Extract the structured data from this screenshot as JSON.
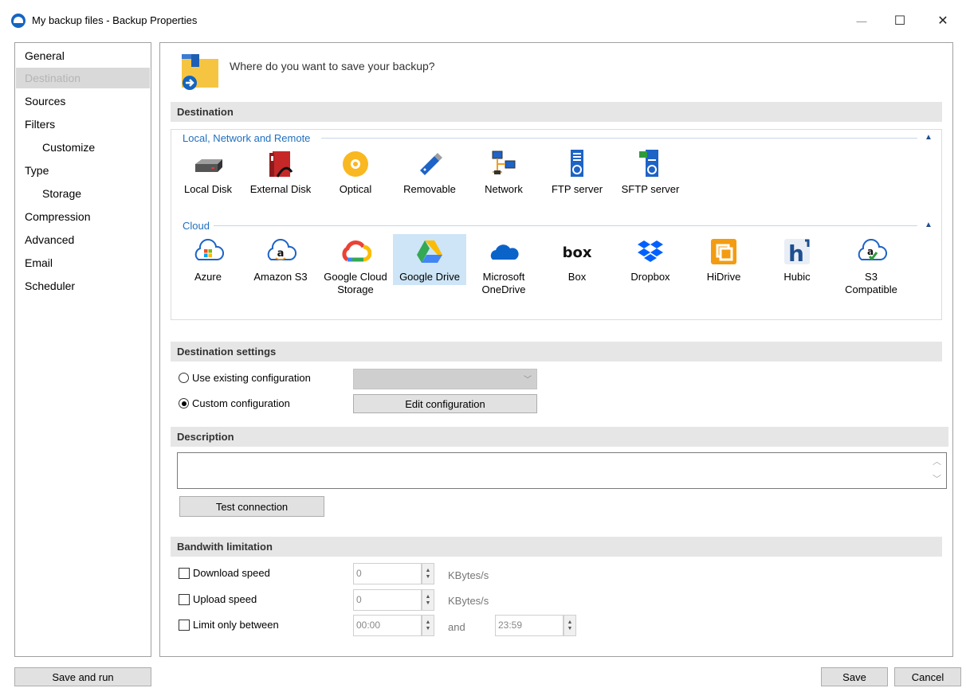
{
  "window": {
    "title": "My backup files - Backup Properties",
    "minimize_glyph": "—",
    "maximize_glyph": "☐",
    "close_glyph": "✕"
  },
  "sidebar": {
    "items": [
      {
        "label": "General"
      },
      {
        "label": "Destination"
      },
      {
        "label": "Sources"
      },
      {
        "label": "Filters"
      },
      {
        "label": "Customize"
      },
      {
        "label": "Type"
      },
      {
        "label": "Storage"
      },
      {
        "label": "Compression"
      },
      {
        "label": "Advanced"
      },
      {
        "label": "Email"
      },
      {
        "label": "Scheduler"
      }
    ]
  },
  "main": {
    "prompt": "Where do you want to save your backup?",
    "destination_header": "Destination",
    "local_group_title": "Local, Network and Remote",
    "cloud_group_title": "Cloud",
    "collapse_glyph": "▲",
    "local_items": [
      {
        "label": "Local Disk"
      },
      {
        "label": "External Disk"
      },
      {
        "label": "Optical"
      },
      {
        "label": "Removable"
      },
      {
        "label": "Network"
      },
      {
        "label": "FTP server"
      },
      {
        "label": "SFTP server"
      }
    ],
    "cloud_items": [
      {
        "label1": "Azure",
        "label2": ""
      },
      {
        "label1": "Amazon S3",
        "label2": ""
      },
      {
        "label1": "Google Cloud",
        "label2": "Storage"
      },
      {
        "label1": "Google Drive",
        "label2": ""
      },
      {
        "label1": "Microsoft",
        "label2": "OneDrive"
      },
      {
        "label1": "Box",
        "label2": ""
      },
      {
        "label1": "Dropbox",
        "label2": ""
      },
      {
        "label1": "HiDrive",
        "label2": ""
      },
      {
        "label1": "Hubic",
        "label2": ""
      },
      {
        "label1": "S3",
        "label2": "Compatible"
      }
    ],
    "selected_destination": "Google Drive",
    "dest_settings_header": "Destination settings",
    "use_existing_label": "Use existing configuration",
    "custom_config_label": "Custom configuration",
    "edit_config_button": "Edit configuration",
    "description_header": "Description",
    "description_value": "",
    "test_connection_button": "Test connection",
    "bandwidth_header": "Bandwith limitation",
    "download_label": "Download speed",
    "download_value": "0",
    "upload_label": "Upload speed",
    "upload_value": "0",
    "unit": "KBytes/s",
    "limit_between_label": "Limit only between",
    "time_from": "00:00",
    "and_label": "and",
    "time_to": "23:59"
  },
  "footer": {
    "save_and_run": "Save and run",
    "save": "Save",
    "cancel": "Cancel"
  },
  "colors": {
    "accent": "#1f6fbf",
    "selected_bg": "#cde5f7",
    "section_bg": "#e6e6e6"
  }
}
